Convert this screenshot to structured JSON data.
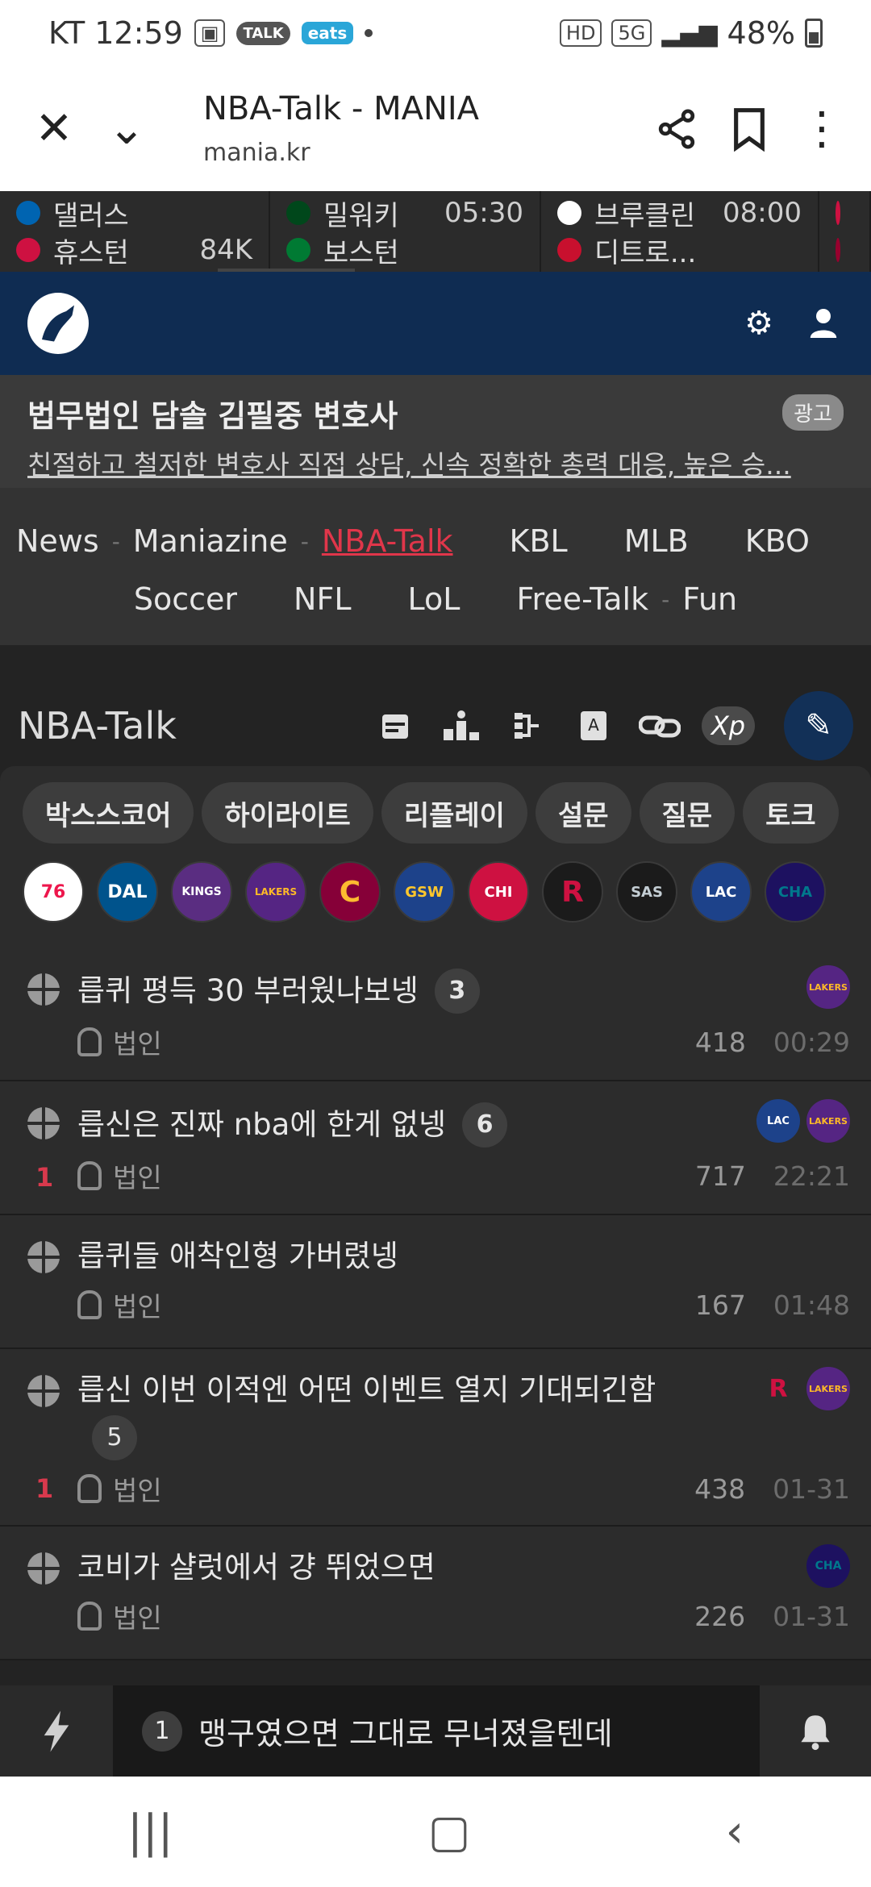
{
  "status_bar": {
    "carrier_time": "KT 12:59",
    "talk_label": "TALK",
    "eats_label": "eats",
    "hd_label": "HD",
    "network": "5G",
    "battery": "48%"
  },
  "browser": {
    "title": "NBA-Talk - MANIA",
    "url": "mania.kr"
  },
  "ticker": [
    {
      "team_a": "댈러스",
      "team_b": "휴스턴",
      "info_a": "",
      "info_b": "84K",
      "color_a": "#0064b1",
      "color_b": "#ce1141"
    },
    {
      "team_a": "밀워키",
      "team_b": "보스턴",
      "info_a": "05:30",
      "info_b": "",
      "color_a": "#00471b",
      "color_b": "#007a33"
    },
    {
      "team_a": "브루클린",
      "team_b": "디트로...",
      "info_a": "08:00",
      "info_b": "",
      "color_a": "#ffffff",
      "color_b": "#c8102e"
    },
    {
      "team_a": "",
      "team_b": "",
      "info_a": "",
      "info_b": "",
      "color_a": "#ce1141",
      "color_b": "#98002e"
    }
  ],
  "header": {
    "logo_icon": "goat-logo-icon",
    "settings_icon": "gear-icon",
    "user_icon": "user-icon",
    "brand_color": "#0f2c52"
  },
  "ad": {
    "title": "법무법인 담솔 김필중 변호사",
    "description": "친절하고 철저한 변호사 직접 상담, 신속 정확한 총력 대응, 높은 승...",
    "badge": "광고"
  },
  "category_nav": {
    "row1": [
      "News",
      "Maniazine",
      "NBA-Talk",
      "KBL",
      "MLB",
      "KBO"
    ],
    "row2": [
      "Soccer",
      "NFL",
      "LoL",
      "Free-Talk",
      "Fun"
    ],
    "active": "NBA-Talk",
    "active_color": "#e0364a"
  },
  "board": {
    "title": "NBA-Talk",
    "tools": [
      "calendar-icon",
      "ranking-icon",
      "bracket-icon",
      "dictionary-icon",
      "link-icon"
    ],
    "xp_label": "Xp",
    "write_icon": "pencil-icon"
  },
  "tabs": [
    "박스스코어",
    "하이라이트",
    "리플레이",
    "설문",
    "질문",
    "토크"
  ],
  "teams": [
    {
      "abbr": "76",
      "color": "#ed174c"
    },
    {
      "abbr": "DAL",
      "color": "#00538c"
    },
    {
      "abbr": "KINGS",
      "color": "#5a2d81"
    },
    {
      "abbr": "LAKERS",
      "color": "#fdb927"
    },
    {
      "abbr": "C",
      "color": "#860038"
    },
    {
      "abbr": "GSW",
      "color": "#ffc72c"
    },
    {
      "abbr": "CHI",
      "color": "#ce1141"
    },
    {
      "abbr": "R",
      "color": "#ce1141"
    },
    {
      "abbr": "SAS",
      "color": "#c4ced4"
    },
    {
      "abbr": "LAC",
      "color": "#1d428a"
    },
    {
      "abbr": "CHA",
      "color": "#00788c"
    }
  ],
  "posts": [
    {
      "title": "릅퀴 평득 30 부러웠나보넹",
      "comments": "3",
      "author": "법인",
      "views": "418",
      "time": "00:29",
      "likes": "",
      "logos": [
        {
          "abbr": "LAKERS",
          "color": "#fdb927"
        }
      ]
    },
    {
      "title": "릅신은 진짜 nba에 한게 없넹",
      "comments": "6",
      "author": "법인",
      "views": "717",
      "time": "22:21",
      "likes": "1",
      "logos": [
        {
          "abbr": "LAC",
          "color": "#c8102e"
        },
        {
          "abbr": "LAKERS",
          "color": "#fdb927"
        }
      ]
    },
    {
      "title": "릅퀴들 애착인형 가버렸넹",
      "comments": "",
      "author": "법인",
      "views": "167",
      "time": "01:48",
      "likes": "",
      "logos": []
    },
    {
      "title": "릅신 이번 이적엔 어떤 이벤트 열지 기대되긴함",
      "comments": "5",
      "author": "법인",
      "views": "438",
      "time": "01-31",
      "likes": "1",
      "logos": [
        {
          "abbr": "R",
          "color": "#ce1141"
        },
        {
          "abbr": "LAKERS",
          "color": "#fdb927"
        }
      ]
    },
    {
      "title": "코비가 샬럿에서 걍 뛰었으면",
      "comments": "",
      "author": "법인",
      "views": "226",
      "time": "01-31",
      "likes": "",
      "logos": [
        {
          "abbr": "CHA",
          "color": "#00788c"
        }
      ]
    }
  ],
  "notification": {
    "flash_icon": "lightning-icon",
    "number": "1",
    "text": "맹구였으면 그대로 무너졌을텐데",
    "bell_icon": "bell-icon"
  },
  "android_nav": {
    "recents": "|||",
    "home": "▢",
    "back": "‹"
  }
}
